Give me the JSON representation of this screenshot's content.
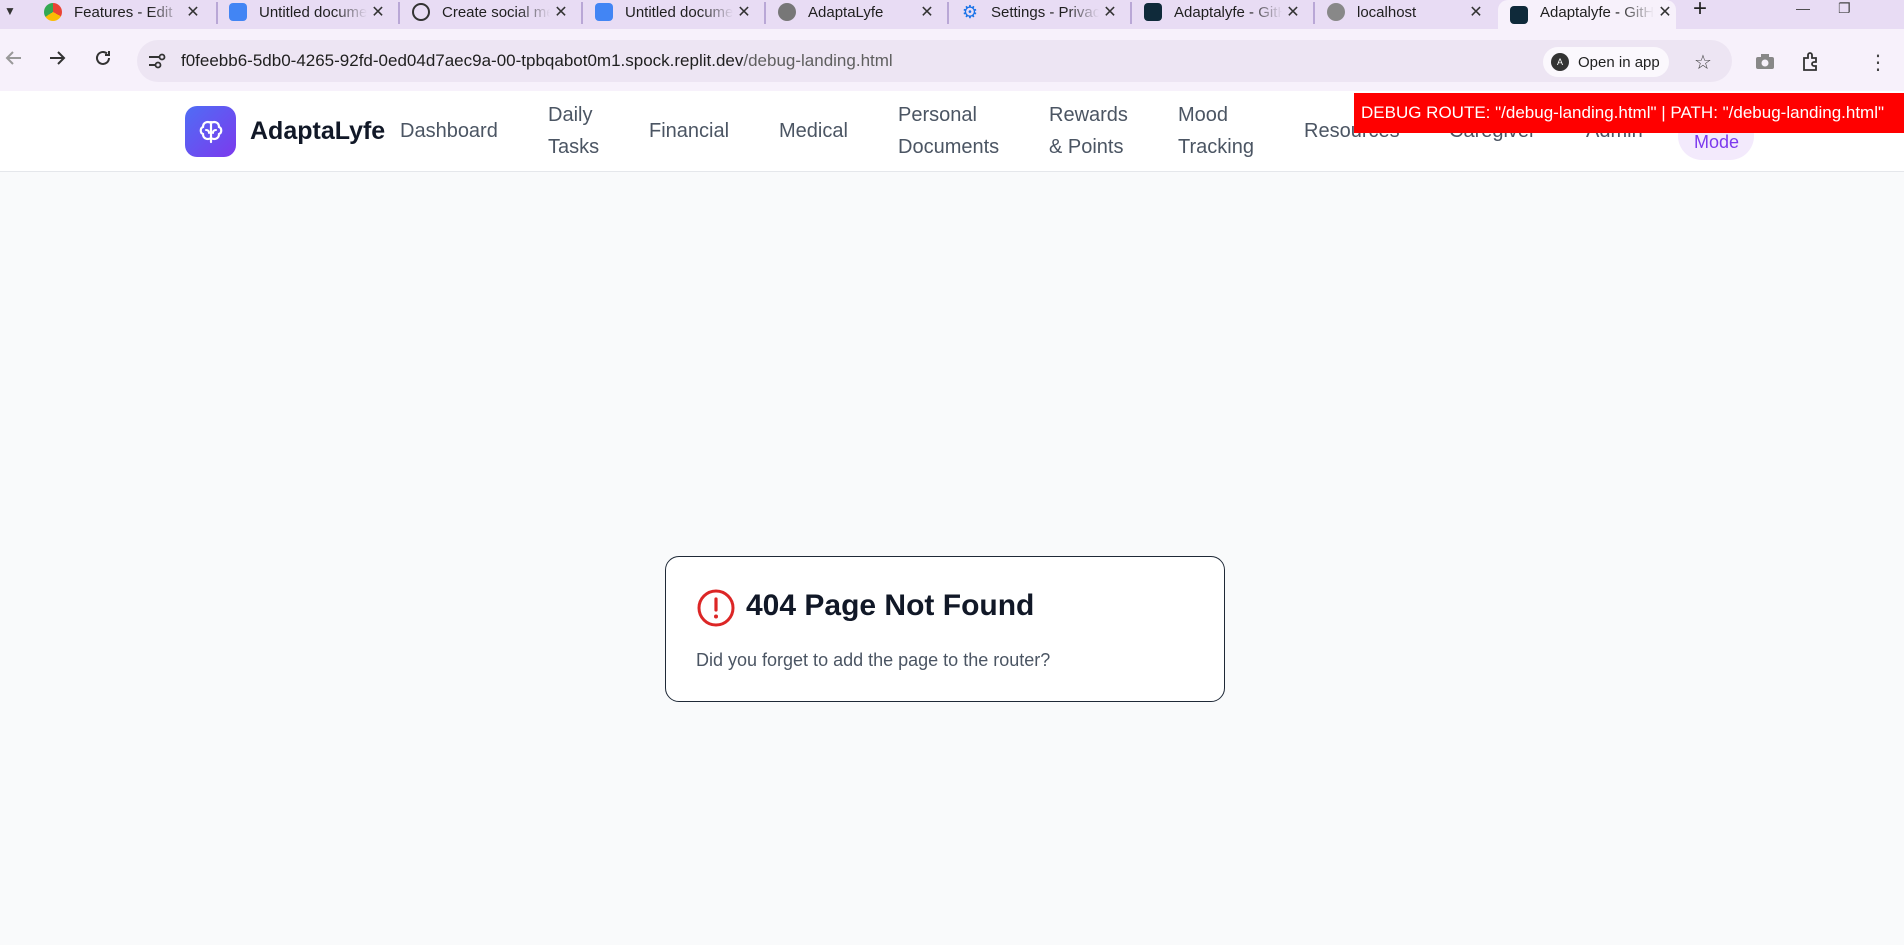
{
  "browser": {
    "tabs": [
      {
        "title": "Features - Edit",
        "icon": "chrome-icon"
      },
      {
        "title": "Untitled document",
        "icon": "google-docs-icon"
      },
      {
        "title": "Create social media",
        "icon": "openai-icon"
      },
      {
        "title": "Untitled document",
        "icon": "google-docs-icon"
      },
      {
        "title": "AdaptaLyfe",
        "icon": "globe-icon"
      },
      {
        "title": "Settings - Privacy",
        "icon": "settings-gear-icon"
      },
      {
        "title": "Adaptalyfe - GitHub",
        "icon": "adaptalyfe-icon"
      },
      {
        "title": "localhost",
        "icon": "globe-icon"
      },
      {
        "title": "Adaptalyfe - GitHub",
        "icon": "adaptalyfe-icon",
        "active": true
      }
    ],
    "url_host": "f0feebb6-5db0-4265-92fd-0ed04d7aec9a-00-tpbqabot0m1.spock.replit.dev",
    "url_path": "/debug-landing.html",
    "open_in_app_label": "Open in app",
    "open_in_app_badge": "A"
  },
  "header": {
    "brand": "AdaptaLyfe",
    "nav": {
      "dashboard": "Dashboard",
      "daily_tasks": [
        "Daily",
        "Tasks"
      ],
      "financial": "Financial",
      "medical": "Medical",
      "personal_documents": [
        "Personal",
        "Documents"
      ],
      "rewards_points": [
        "Rewards",
        "& Points"
      ],
      "mood_tracking": [
        "Mood",
        "Tracking"
      ],
      "resources": "Resources",
      "caregiver": "Caregiver",
      "admin": "Admin",
      "mode": "Mode"
    },
    "debug_banner": "DEBUG ROUTE: \"/debug-landing.html\" | PATH: \"/debug-landing.html\""
  },
  "error_card": {
    "title": "404 Page Not Found",
    "message": "Did you forget to add the page to the router?"
  },
  "colors": {
    "accent": "#7c3aed",
    "error": "#dc2626",
    "debug_banner": "#ff0000",
    "tabstrip": "#e8dcf4"
  }
}
